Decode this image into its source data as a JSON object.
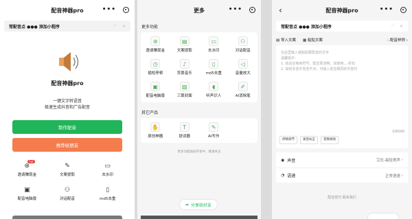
{
  "p1": {
    "title": "配音神器pro",
    "banner_text": "常配音点 ●●● 添加小程序",
    "app_name": "配音神器pro",
    "tagline1": "一键文字转语音",
    "tagline2": "极速生成抖音和广告配音",
    "btn_make": "制作配音",
    "btn_recommend": "推荐给朋友",
    "grid": [
      {
        "label": "邀请赚现金",
        "icon": "gift-icon",
        "glyph": "⊛",
        "hot": "hot"
      },
      {
        "label": "文案提取",
        "icon": "pen-icon",
        "glyph": "✎"
      },
      {
        "label": "去水印",
        "icon": "film-icon",
        "glyph": "▭"
      },
      {
        "label": "配音电脑版",
        "icon": "monitor-icon",
        "glyph": "▣"
      },
      {
        "label": "对话配音",
        "icon": "people-icon",
        "glyph": "⚇"
      },
      {
        "label": "md5去重",
        "icon": "file-icon",
        "glyph": "▯"
      }
    ]
  },
  "p2": {
    "title": "更多",
    "section1": "更多功能",
    "section2": "其它产品",
    "features": [
      {
        "label": "邀请赚现金",
        "icon": "gift-icon",
        "glyph": "⊛"
      },
      {
        "label": "文案提取",
        "icon": "text-icon",
        "glyph": "▤"
      },
      {
        "label": "去水印",
        "icon": "eraser-icon",
        "glyph": "▭"
      },
      {
        "label": "对话配音",
        "icon": "people-icon",
        "glyph": "⚇"
      },
      {
        "label": "插短停顿",
        "icon": "clock-icon",
        "glyph": "◷"
      },
      {
        "label": "背景音乐",
        "icon": "music-icon",
        "glyph": "♪"
      },
      {
        "label": "md5去重",
        "icon": "file-icon",
        "glyph": "▯"
      },
      {
        "label": "音量放大",
        "icon": "volume-icon",
        "glyph": "◁"
      },
      {
        "label": "配音电脑版",
        "icon": "monitor-icon",
        "glyph": "▣"
      },
      {
        "label": "三联封面",
        "icon": "image-icon",
        "glyph": "▨"
      },
      {
        "label": "听声识人",
        "icon": "ear-icon",
        "glyph": "◖"
      },
      {
        "label": "AI消除笔",
        "icon": "brush-icon",
        "glyph": "✐"
      }
    ],
    "products": [
      {
        "label": "原创神器",
        "icon": "thumb-icon",
        "glyph": "✋"
      },
      {
        "label": "提词器",
        "icon": "teleprompter-icon",
        "glyph": "T"
      },
      {
        "label": "AI写作",
        "icon": "write-icon",
        "glyph": "✎"
      }
    ],
    "note": "更多功能陆续开发中，敬请关注",
    "share": "分享给好友"
  },
  "p3": {
    "title": "配音神器pro",
    "banner_text": "常配音点 ●●● 添加小程序",
    "import": "导入文案",
    "paste": "粘贴文案",
    "example": "配音样例",
    "placeholder": [
      "在这里输入或粘贴要配音的文字",
      "温馨提示：",
      "1. 前后空格用符号，配音更流畅，如使用、。·折扣",
      "2. 如有多音字发音不对，可输入发音相同的字替代"
    ],
    "count": "0/8000",
    "tags": [
      "停顿调节",
      "发音纠正",
      "音频调语"
    ],
    "voice_label": "声音",
    "voice_value": "艾伦-晨轻男声",
    "speed_label": "语速",
    "speed_value": "正常语速",
    "footer": "配音技巧    联系我们"
  }
}
